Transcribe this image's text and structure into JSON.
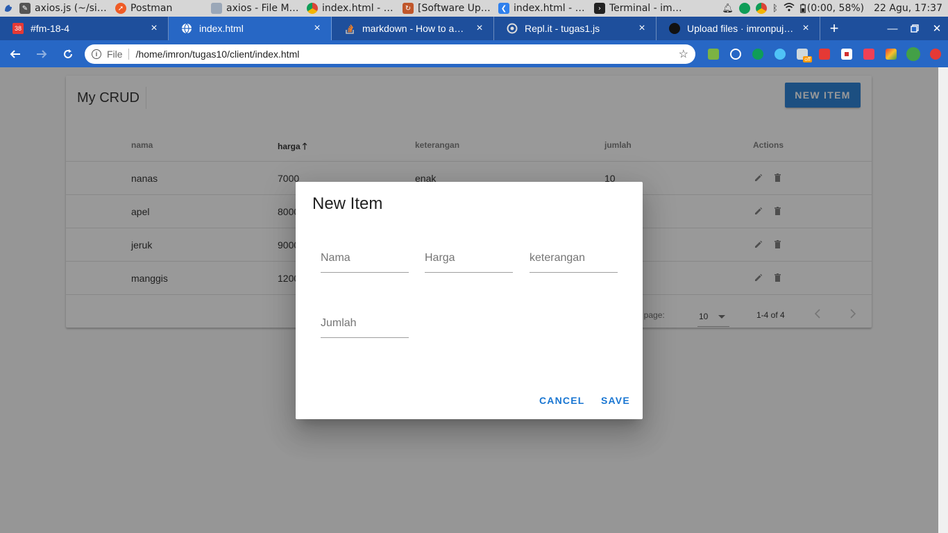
{
  "taskbar": {
    "tasks": [
      {
        "label": "axios.js (~/sia...",
        "icon": "text-editor-icon",
        "color": "#444444"
      },
      {
        "label": "Postman",
        "icon": "postman-icon",
        "color": "#ef5b25"
      },
      {
        "label": "axios - File Ma...",
        "icon": "folder-icon",
        "color": "#9aa7b8"
      },
      {
        "label": "index.html - G...",
        "icon": "chrome-icon",
        "color": "#db4437"
      },
      {
        "label": "[Software Upd...",
        "icon": "software-update-icon",
        "color": "#c0572b"
      },
      {
        "label": "index.html - cli...",
        "icon": "vscode-icon",
        "color": "#2f80ed"
      },
      {
        "label": "Terminal - imr...",
        "icon": "terminal-icon",
        "color": "#222222"
      }
    ],
    "battery": "(0:00, 58%)",
    "clock": "22 Agu, 17:37"
  },
  "tabs": [
    {
      "title": "#fm-18-4",
      "icon": "calendar-icon",
      "color": "#e53935",
      "badge": "38"
    },
    {
      "title": "index.html",
      "icon": "globe-icon",
      "color": "#ffffff",
      "active": true
    },
    {
      "title": "markdown - How to add s",
      "icon": "stackoverflow-icon",
      "color": "#f48024"
    },
    {
      "title": "Repl.it - tugas1.js",
      "icon": "replit-icon",
      "color": "#dddddd"
    },
    {
      "title": "Upload files · imronpuji/ar",
      "icon": "github-icon",
      "color": "#111111"
    }
  ],
  "addressbar": {
    "scheme": "File",
    "url": "/home/imron/tugas10/client/index.html",
    "extension_badge": "off"
  },
  "app": {
    "title": "My CRUD",
    "new_item_label": "NEW ITEM",
    "headers": [
      "nama",
      "harga",
      "keterangan",
      "jumlah",
      "Actions"
    ],
    "sorted_column": "harga",
    "rows": [
      {
        "nama": "nanas",
        "harga": "7000",
        "keterangan": "enak",
        "jumlah": "10"
      },
      {
        "nama": "apel",
        "harga": "8000",
        "keterangan": "",
        "jumlah": ""
      },
      {
        "nama": "jeruk",
        "harga": "9000",
        "keterangan": "",
        "jumlah": ""
      },
      {
        "nama": "manggis",
        "harga": "1200",
        "keterangan": "",
        "jumlah": ""
      }
    ],
    "rows_per_page_label": "ber page:",
    "rows_per_page_value": "10",
    "page_range": "1-4 of 4"
  },
  "dialog": {
    "title": "New Item",
    "fields": {
      "nama": {
        "placeholder": "Nama",
        "value": ""
      },
      "harga": {
        "placeholder": "Harga",
        "value": ""
      },
      "keterangan": {
        "placeholder": "keterangan",
        "value": ""
      },
      "jumlah": {
        "placeholder": "Jumlah",
        "value": ""
      }
    },
    "cancel_label": "CANCEL",
    "save_label": "SAVE"
  },
  "colors": {
    "tab_bar": "#1e4f9c",
    "toolbar": "#2767c5",
    "primary": "#1976d2"
  }
}
